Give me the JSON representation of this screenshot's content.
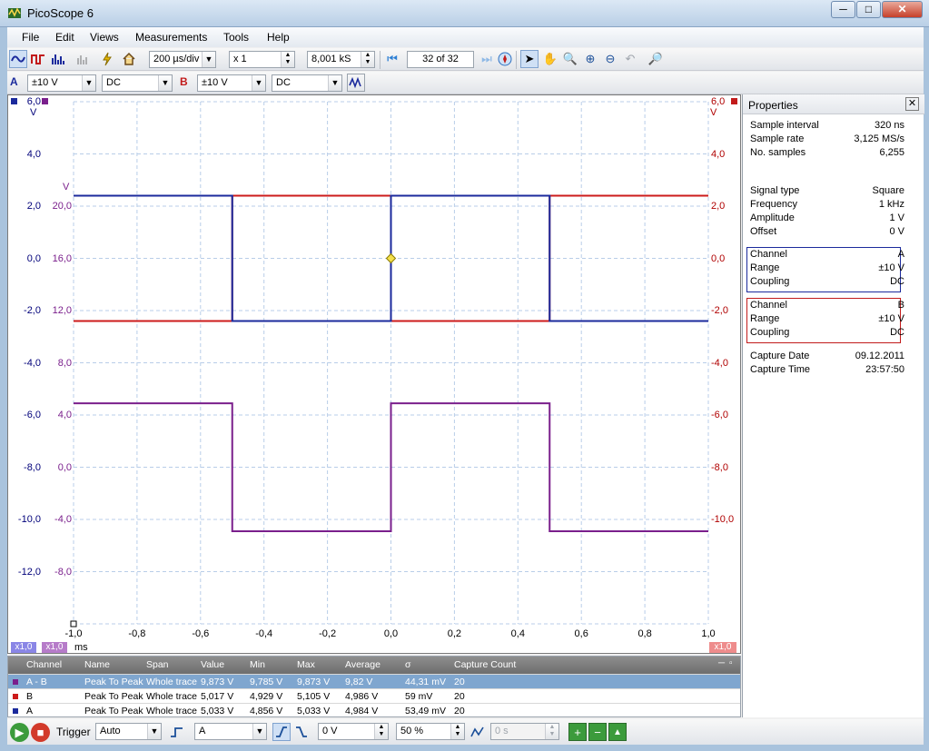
{
  "window": {
    "title": "PicoScope 6",
    "min": "─",
    "max": "□",
    "close": "✕"
  },
  "menu": [
    "File",
    "Edit",
    "Views",
    "Measurements",
    "Tools",
    "Help"
  ],
  "toolbar": {
    "timebase": "200 µs/div",
    "zoom": "x 1",
    "samples": "8,001 kS",
    "page": "32  of 32"
  },
  "channels": {
    "a_label": "A",
    "a_range": "±10 V",
    "a_coupling": "DC",
    "b_label": "B",
    "b_range": "±10 V",
    "b_coupling": "DC"
  },
  "colors": {
    "channel_a": "#1b2a9c",
    "channel_b": "#cc1b1b",
    "math": "#7a1f8c",
    "grid": "#b8cde8",
    "trigger": "#f5e04b"
  },
  "scope": {
    "left_axis_unit": "V",
    "right_axis_unit": "V",
    "math_axis_unit": "V",
    "left_ticks": [
      "6,0",
      "4,0",
      "2,0",
      "0,0",
      "-2,0",
      "-4,0",
      "-6,0",
      "-8,0",
      "-10,0",
      "-12,0"
    ],
    "right_ticks": [
      "6,0",
      "4,0",
      "2,0",
      "0,0",
      "-2,0",
      "-4,0",
      "-6,0",
      "-8,0",
      "-10,0"
    ],
    "math_ticks": [
      "20,0",
      "16,0",
      "12,0",
      "8,0",
      "4,0",
      "0,0",
      "-4,0",
      "-8,0"
    ],
    "x_ticks": [
      "-1,0",
      "-0,8",
      "-0,6",
      "-0,4",
      "-0,2",
      "0,0",
      "0,2",
      "0,4",
      "0,6",
      "0,8",
      "1,0"
    ],
    "x_unit": "ms",
    "zoom_a": "x1,0",
    "zoom_math": "x1,0",
    "zoom_b": "x1,0"
  },
  "properties": {
    "title": "Properties",
    "rows1": [
      [
        "Sample interval",
        "320 ns"
      ],
      [
        "Sample rate",
        "3,125 MS/s"
      ],
      [
        "No. samples",
        "6,255"
      ]
    ],
    "rows2": [
      [
        "Signal type",
        "Square"
      ],
      [
        "Frequency",
        "1 kHz"
      ],
      [
        "Amplitude",
        "1 V"
      ],
      [
        "Offset",
        "0 V"
      ]
    ],
    "chan_a": [
      [
        "Channel",
        "A"
      ],
      [
        "Range",
        "±10 V"
      ],
      [
        "Coupling",
        "DC"
      ]
    ],
    "chan_b": [
      [
        "Channel",
        "B"
      ],
      [
        "Range",
        "±10 V"
      ],
      [
        "Coupling",
        "DC"
      ]
    ],
    "capture": [
      [
        "Capture Date",
        "09.12.2011"
      ],
      [
        "Capture Time",
        "23:57:50"
      ]
    ]
  },
  "measurements": {
    "headers": [
      "Channel",
      "Name",
      "Span",
      "Value",
      "Min",
      "Max",
      "Average",
      "σ",
      "Capture Count"
    ],
    "rows": [
      [
        "A - B",
        "Peak To Peak",
        "Whole trace",
        "9,873 V",
        "9,785 V",
        "9,873 V",
        "9,82 V",
        "44,31 mV",
        "20"
      ],
      [
        "B",
        "Peak To Peak",
        "Whole trace",
        "5,017 V",
        "4,929 V",
        "5,105 V",
        "4,986 V",
        "59 mV",
        "20"
      ],
      [
        "A",
        "Peak To Peak",
        "Whole trace",
        "5,033 V",
        "4,856 V",
        "5,033 V",
        "4,984 V",
        "53,49 mV",
        "20"
      ]
    ]
  },
  "status": {
    "trigger_label": "Trigger",
    "trigger_mode": "Auto",
    "trigger_source": "A",
    "threshold": "0 V",
    "position": "50 %",
    "delay": "0 s"
  }
}
